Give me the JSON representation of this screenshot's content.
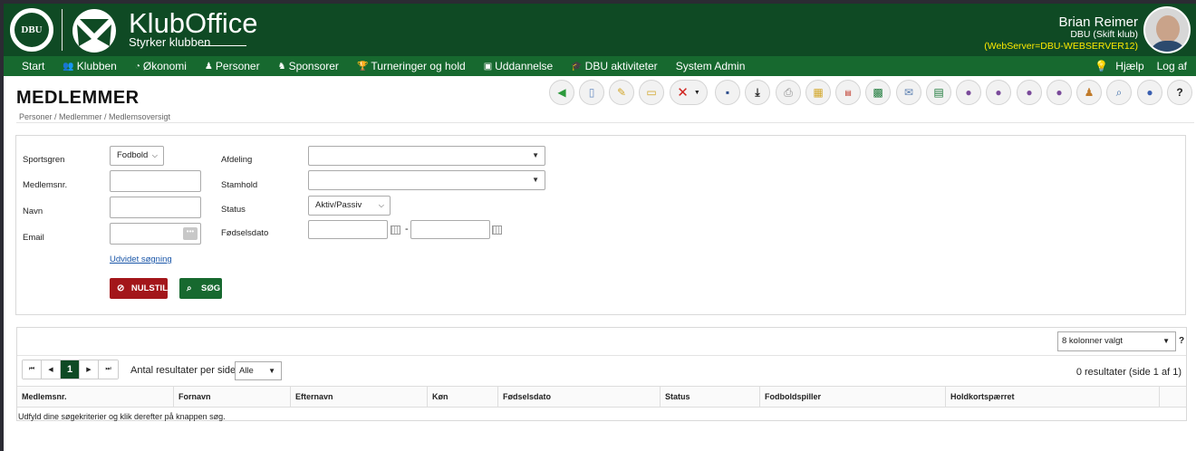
{
  "app": {
    "title": "KlubOffice",
    "subtitle": "Styrker klubben",
    "org_logo_text": "DBU"
  },
  "user": {
    "name": "Brian Reimer",
    "club": "DBU (Skift klub)",
    "server": "(WebServer=DBU-WEBSERVER12)"
  },
  "nav": {
    "items": [
      {
        "label": "Start",
        "icon": ""
      },
      {
        "label": "Klubben",
        "icon": "people-icon"
      },
      {
        "label": "Økonomi",
        "icon": "coins-icon"
      },
      {
        "label": "Personer",
        "icon": "person-icon"
      },
      {
        "label": "Sponsorer",
        "icon": "sponsor-icon"
      },
      {
        "label": "Turneringer og hold",
        "icon": "trophy-icon"
      },
      {
        "label": "Uddannelse",
        "icon": "monitor-icon"
      },
      {
        "label": "DBU aktiviteter",
        "icon": "cap-icon"
      },
      {
        "label": "System Admin",
        "icon": ""
      }
    ],
    "help": "Hjælp",
    "logout": "Log af"
  },
  "page": {
    "title": "MEDLEMMER",
    "breadcrumb": "Personer / Medlemmer / Medlemsoversigt"
  },
  "toolbar": [
    "back-icon",
    "new-document-icon",
    "edit-icon",
    "open-folder-icon",
    "delete-icon",
    "save-icon",
    "download-icon",
    "print-icon",
    "columns-icon",
    "pdf-icon",
    "excel-icon",
    "email-icon",
    "export-icon",
    "group-add-icon",
    "group-link-icon",
    "group-edit-icon",
    "group-remove-icon",
    "person-transfer-icon",
    "search-icon",
    "info-icon",
    "help-icon"
  ],
  "search": {
    "sport_label": "Sportsgren",
    "sport_value": "Fodbold",
    "member_no_label": "Medlemsnr.",
    "name_label": "Navn",
    "email_label": "Email",
    "dept_label": "Afdeling",
    "dept_value": "",
    "team_label": "Stamhold",
    "team_value": "",
    "status_label": "Status",
    "status_value": "Aktiv/Passiv",
    "birth_label": "Fødselsdato",
    "birth_separator": "-",
    "advanced_link": "Udvidet søgning",
    "reset_button": "NULSTIL",
    "search_button": "SØG"
  },
  "results": {
    "columns_selected": "8 kolonner valgt",
    "help_mark": "?",
    "current_page": "1",
    "per_page_label": "Antal resultater per side",
    "per_page_value": "Alle",
    "count_text": "0 resultater (side 1 af 1)",
    "headers": [
      "Medlemsnr.",
      "Fornavn",
      "Efternavn",
      "Køn",
      "Fødselsdato",
      "Status",
      "Fodboldspiller",
      "Holdkortspærret"
    ],
    "empty_message": "Udfyld dine søgekriterier og klik derefter på knappen søg."
  },
  "colors": {
    "header_bg": "#0f4a24",
    "nav_bg": "#17692f",
    "reset_red": "#a3161a",
    "server_yellow": "#ffea00"
  }
}
